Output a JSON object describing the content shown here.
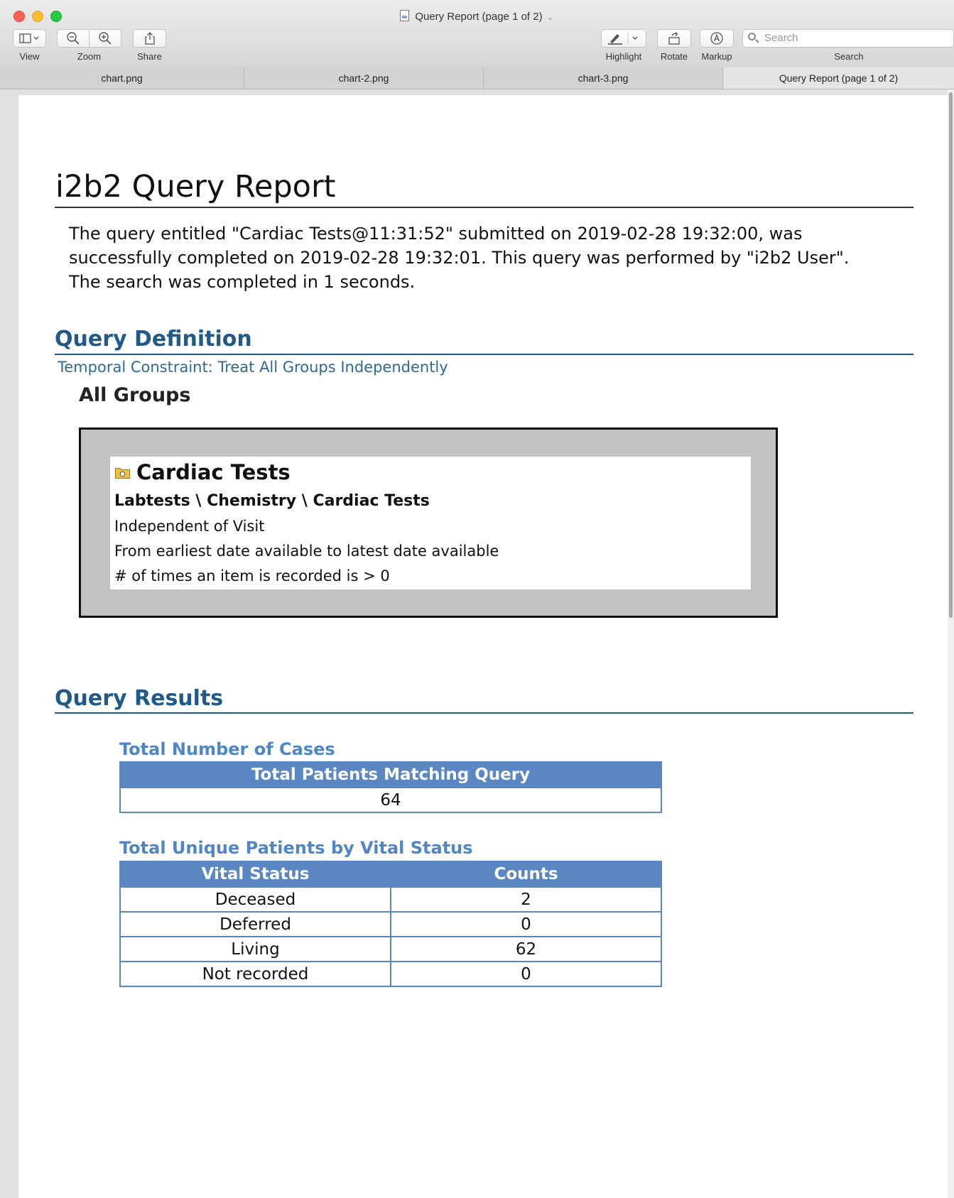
{
  "window": {
    "title": "Query Report (page 1 of 2)"
  },
  "toolbar": {
    "view_label": "View",
    "zoom_label": "Zoom",
    "share_label": "Share",
    "highlight_label": "Highlight",
    "rotate_label": "Rotate",
    "markup_label": "Markup",
    "search_label": "Search",
    "search_placeholder": "Search"
  },
  "tabs": [
    {
      "label": "chart.png"
    },
    {
      "label": "chart-2.png"
    },
    {
      "label": "chart-3.png"
    },
    {
      "label": "Query Report (page 1 of 2)",
      "active": true
    }
  ],
  "report": {
    "title": "i2b2 Query Report",
    "intro": "The query entitled \"Cardiac Tests@11:31:52\" submitted on 2019-02-28 19:32:00, was successfully completed on 2019-02-28 19:32:01. This query was performed by \"i2b2 User\". The search was completed in 1 seconds.",
    "definition_heading": "Query Definition",
    "temporal_constraint": "Temporal Constraint: Treat All Groups Independently",
    "groups_heading": "All Groups",
    "concept": {
      "title": "Cardiac Tests",
      "path": "Labtests \\ Chemistry \\ Cardiac Tests",
      "visit": "Independent of Visit",
      "date_range": "From earliest date available to latest date available",
      "occurrence": "# of times an item is recorded is > 0"
    },
    "results_heading": "Query Results",
    "total_cases": {
      "heading": "Total Number of Cases",
      "column": "Total Patients Matching Query",
      "value": "64"
    },
    "vital_status": {
      "heading": "Total Unique Patients by Vital Status",
      "columns": [
        "Vital Status",
        "Counts"
      ],
      "rows": [
        {
          "status": "Deceased",
          "count": "2"
        },
        {
          "status": "Deferred",
          "count": "0"
        },
        {
          "status": "Living",
          "count": "62"
        },
        {
          "status": "Not recorded",
          "count": "0"
        }
      ]
    }
  },
  "colors": {
    "heading_blue": "#1f5a8a",
    "table_header": "#5a87c2",
    "subheading_blue": "#4f86c6",
    "group_box_gray": "#c2c2c2"
  }
}
